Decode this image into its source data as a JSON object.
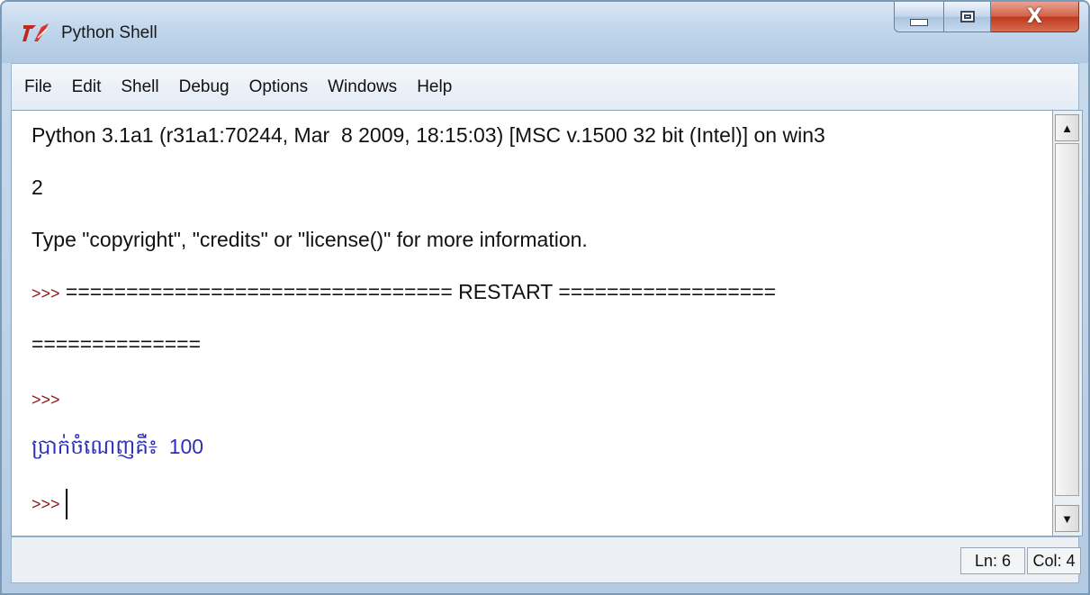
{
  "window": {
    "title": "Python Shell",
    "controls": {
      "minimize": "minimize",
      "maximize": "maximize",
      "close": "X"
    }
  },
  "menu": [
    "File",
    "Edit",
    "Shell",
    "Debug",
    "Options",
    "Windows",
    "Help"
  ],
  "editor": {
    "lines": [
      {
        "text": "Python 3.1a1 (r31a1:70244, Mar  8 2009, 18:15:03) [MSC v.1500 32 bit (Intel)] on win3"
      },
      {
        "text": "2"
      },
      {
        "text": "Type \"copyright\", \"credits\" or \"license()\" for more information."
      },
      {
        "prompt": ">>>",
        "text": " ================================ RESTART =================="
      },
      {
        "text": "=============="
      },
      {
        "prompt": ">>>",
        "text": ""
      },
      {
        "text": "ប្រាក់ចំណេញគឺ៖  100"
      },
      {
        "prompt": ">>>",
        "text": ""
      }
    ]
  },
  "status": {
    "line": "Ln: 6",
    "col": "Col: 4"
  },
  "colors": {
    "output_text": "#2d2fb5",
    "prompt_text": "#8b1a1a",
    "close_button": "#c0391f"
  }
}
